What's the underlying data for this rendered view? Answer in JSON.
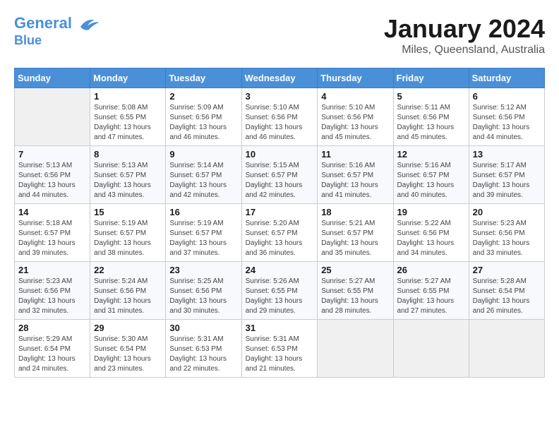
{
  "logo": {
    "line1": "General",
    "line2": "Blue"
  },
  "title": "January 2024",
  "subtitle": "Miles, Queensland, Australia",
  "weekdays": [
    "Sunday",
    "Monday",
    "Tuesday",
    "Wednesday",
    "Thursday",
    "Friday",
    "Saturday"
  ],
  "weeks": [
    [
      {
        "day": "",
        "info": ""
      },
      {
        "day": "1",
        "info": "Sunrise: 5:08 AM\nSunset: 6:55 PM\nDaylight: 13 hours\nand 47 minutes."
      },
      {
        "day": "2",
        "info": "Sunrise: 5:09 AM\nSunset: 6:56 PM\nDaylight: 13 hours\nand 46 minutes."
      },
      {
        "day": "3",
        "info": "Sunrise: 5:10 AM\nSunset: 6:56 PM\nDaylight: 13 hours\nand 46 minutes."
      },
      {
        "day": "4",
        "info": "Sunrise: 5:10 AM\nSunset: 6:56 PM\nDaylight: 13 hours\nand 45 minutes."
      },
      {
        "day": "5",
        "info": "Sunrise: 5:11 AM\nSunset: 6:56 PM\nDaylight: 13 hours\nand 45 minutes."
      },
      {
        "day": "6",
        "info": "Sunrise: 5:12 AM\nSunset: 6:56 PM\nDaylight: 13 hours\nand 44 minutes."
      }
    ],
    [
      {
        "day": "7",
        "info": "Sunrise: 5:13 AM\nSunset: 6:56 PM\nDaylight: 13 hours\nand 44 minutes."
      },
      {
        "day": "8",
        "info": "Sunrise: 5:13 AM\nSunset: 6:57 PM\nDaylight: 13 hours\nand 43 minutes."
      },
      {
        "day": "9",
        "info": "Sunrise: 5:14 AM\nSunset: 6:57 PM\nDaylight: 13 hours\nand 42 minutes."
      },
      {
        "day": "10",
        "info": "Sunrise: 5:15 AM\nSunset: 6:57 PM\nDaylight: 13 hours\nand 42 minutes."
      },
      {
        "day": "11",
        "info": "Sunrise: 5:16 AM\nSunset: 6:57 PM\nDaylight: 13 hours\nand 41 minutes."
      },
      {
        "day": "12",
        "info": "Sunrise: 5:16 AM\nSunset: 6:57 PM\nDaylight: 13 hours\nand 40 minutes."
      },
      {
        "day": "13",
        "info": "Sunrise: 5:17 AM\nSunset: 6:57 PM\nDaylight: 13 hours\nand 39 minutes."
      }
    ],
    [
      {
        "day": "14",
        "info": "Sunrise: 5:18 AM\nSunset: 6:57 PM\nDaylight: 13 hours\nand 39 minutes."
      },
      {
        "day": "15",
        "info": "Sunrise: 5:19 AM\nSunset: 6:57 PM\nDaylight: 13 hours\nand 38 minutes."
      },
      {
        "day": "16",
        "info": "Sunrise: 5:19 AM\nSunset: 6:57 PM\nDaylight: 13 hours\nand 37 minutes."
      },
      {
        "day": "17",
        "info": "Sunrise: 5:20 AM\nSunset: 6:57 PM\nDaylight: 13 hours\nand 36 minutes."
      },
      {
        "day": "18",
        "info": "Sunrise: 5:21 AM\nSunset: 6:57 PM\nDaylight: 13 hours\nand 35 minutes."
      },
      {
        "day": "19",
        "info": "Sunrise: 5:22 AM\nSunset: 6:56 PM\nDaylight: 13 hours\nand 34 minutes."
      },
      {
        "day": "20",
        "info": "Sunrise: 5:23 AM\nSunset: 6:56 PM\nDaylight: 13 hours\nand 33 minutes."
      }
    ],
    [
      {
        "day": "21",
        "info": "Sunrise: 5:23 AM\nSunset: 6:56 PM\nDaylight: 13 hours\nand 32 minutes."
      },
      {
        "day": "22",
        "info": "Sunrise: 5:24 AM\nSunset: 6:56 PM\nDaylight: 13 hours\nand 31 minutes."
      },
      {
        "day": "23",
        "info": "Sunrise: 5:25 AM\nSunset: 6:56 PM\nDaylight: 13 hours\nand 30 minutes."
      },
      {
        "day": "24",
        "info": "Sunrise: 5:26 AM\nSunset: 6:55 PM\nDaylight: 13 hours\nand 29 minutes."
      },
      {
        "day": "25",
        "info": "Sunrise: 5:27 AM\nSunset: 6:55 PM\nDaylight: 13 hours\nand 28 minutes."
      },
      {
        "day": "26",
        "info": "Sunrise: 5:27 AM\nSunset: 6:55 PM\nDaylight: 13 hours\nand 27 minutes."
      },
      {
        "day": "27",
        "info": "Sunrise: 5:28 AM\nSunset: 6:54 PM\nDaylight: 13 hours\nand 26 minutes."
      }
    ],
    [
      {
        "day": "28",
        "info": "Sunrise: 5:29 AM\nSunset: 6:54 PM\nDaylight: 13 hours\nand 24 minutes."
      },
      {
        "day": "29",
        "info": "Sunrise: 5:30 AM\nSunset: 6:54 PM\nDaylight: 13 hours\nand 23 minutes."
      },
      {
        "day": "30",
        "info": "Sunrise: 5:31 AM\nSunset: 6:53 PM\nDaylight: 13 hours\nand 22 minutes."
      },
      {
        "day": "31",
        "info": "Sunrise: 5:31 AM\nSunset: 6:53 PM\nDaylight: 13 hours\nand 21 minutes."
      },
      {
        "day": "",
        "info": ""
      },
      {
        "day": "",
        "info": ""
      },
      {
        "day": "",
        "info": ""
      }
    ]
  ]
}
